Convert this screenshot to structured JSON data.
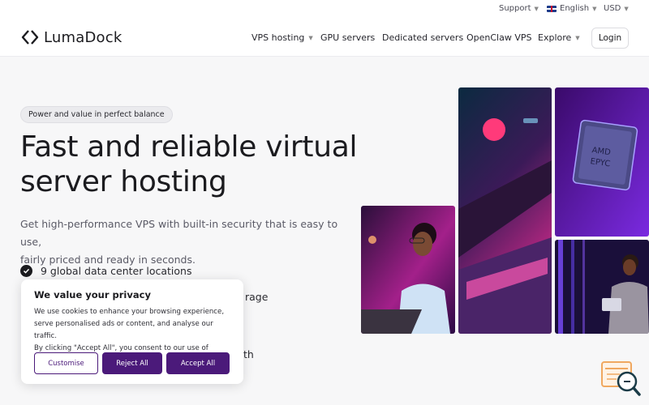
{
  "topbar": {
    "support": "Support",
    "language": "English",
    "currency": "USD"
  },
  "brand": {
    "name": "LumaDock"
  },
  "nav": {
    "items": [
      "VPS hosting",
      "GPU servers",
      "Dedicated servers",
      "OpenClaw VPS",
      "Explore"
    ],
    "login": "Login"
  },
  "hero": {
    "badge": "Power and value in perfect balance",
    "title_line1": "Fast and reliable virtual",
    "title_line2": "server hosting",
    "subtitle_line1": "Get high-performance VPS with built-in security that is easy to use,",
    "subtitle_line2": "fairly priced and ready in seconds.",
    "features": [
      "9 global data center locations",
      "rage",
      "th"
    ]
  },
  "photos": {
    "chip_text_1": "AMD",
    "chip_text_2": "EPYC"
  },
  "cookie": {
    "title": "We value your privacy",
    "body_line1": "We use cookies to enhance your browsing experience,",
    "body_line2": "serve personalised ads or content, and analyse our traffic.",
    "body_line3": "By clicking \"Accept All\", you consent to our use of cookies.",
    "customise": "Customise",
    "reject": "Reject All",
    "accept": "Accept All"
  },
  "colors": {
    "accent": "#4b1a7a",
    "text": "#1b1b1f",
    "background": "#f7f7f8"
  }
}
